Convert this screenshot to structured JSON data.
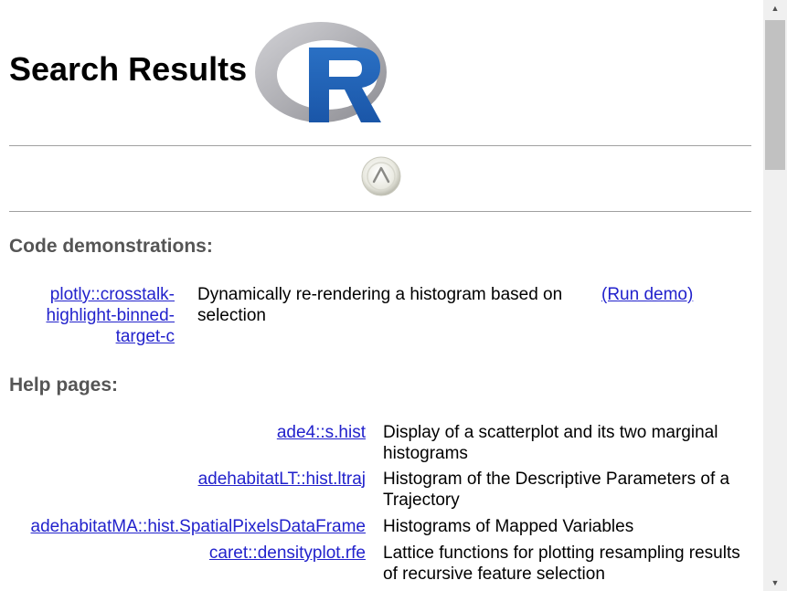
{
  "header": {
    "title": "Search Results"
  },
  "nav": {
    "up_icon": "up-arrow-icon"
  },
  "demos": {
    "heading": "Code demonstrations:",
    "items": [
      {
        "link": "plotly::crosstalk-highlight-binned-target-c",
        "link_lines": [
          "plotly::crosstalk-",
          "highlight-binned-",
          "target-c"
        ],
        "description": "Dynamically re-rendering a histogram based on selection",
        "run_label": "(Run demo)"
      }
    ]
  },
  "help": {
    "heading": "Help pages:",
    "items": [
      {
        "link": "ade4::s.hist",
        "description": "Display of a scatterplot and its two marginal histograms"
      },
      {
        "link": "adehabitatLT::hist.ltraj",
        "description": "Histogram of the Descriptive Parameters of a Trajectory"
      },
      {
        "link": "adehabitatMA::hist.SpatialPixelsDataFrame",
        "description": "Histograms of Mapped Variables"
      },
      {
        "link": "caret::densityplot.rfe",
        "description": "Lattice functions for plotting resampling results of recursive feature selection"
      }
    ]
  },
  "colors": {
    "link": "#2222cc",
    "heading": "#555555",
    "logo_blue": "#2065b8",
    "logo_gray": "#a8a8ac"
  }
}
